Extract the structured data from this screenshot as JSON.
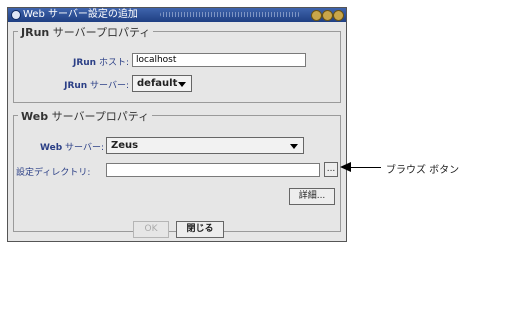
{
  "window": {
    "title": "Web サーバー設定の追加"
  },
  "jrun_group": {
    "title_bold": "JRun",
    "title_rest": " サーバープロパティ",
    "host_label_bold": "JRun",
    "host_label_rest": " ホスト:",
    "host_value": "localhost",
    "server_label_bold": "JRun",
    "server_label_rest": " サーバー:",
    "server_value": "default"
  },
  "web_group": {
    "title_bold": "Web",
    "title_rest": " サーバープロパティ",
    "server_label_bold": "Web",
    "server_label_rest": " サーバー:",
    "server_value": "Zeus",
    "dir_label": "設定ディレクトリ:",
    "dir_value": "",
    "browse_label": "...",
    "details_label": "詳細..."
  },
  "footer": {
    "ok_label": "OK",
    "close_label": "閉じる"
  },
  "callout": {
    "text": "ブラウズ ボタン"
  },
  "colors": {
    "titlebar": "#2c4d94",
    "label_blue": "#2b3f86",
    "dialog_bg": "#e6e6e6"
  }
}
